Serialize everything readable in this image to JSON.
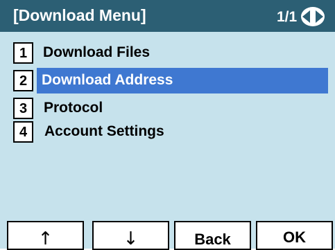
{
  "header": {
    "title": "[Download Menu]",
    "page": "1/1",
    "scroll_icon": "left-right-arrows-icon"
  },
  "menu": {
    "selected_index": 1,
    "items": [
      {
        "number": "1",
        "label": "Download Files"
      },
      {
        "number": "2",
        "label": "Download Address"
      },
      {
        "number": "3",
        "label": "Protocol"
      },
      {
        "number": "4",
        "label": "Account Settings"
      }
    ]
  },
  "softkeys": [
    {
      "label": "↑",
      "icon": "up-arrow-icon"
    },
    {
      "label": "↓",
      "icon": "down-arrow-icon"
    },
    {
      "label": "Back"
    },
    {
      "label": "OK"
    }
  ],
  "colors": {
    "header_bg": "#2c5f74",
    "screen_bg": "#c6e2ec",
    "highlight": "#3f78d1"
  }
}
